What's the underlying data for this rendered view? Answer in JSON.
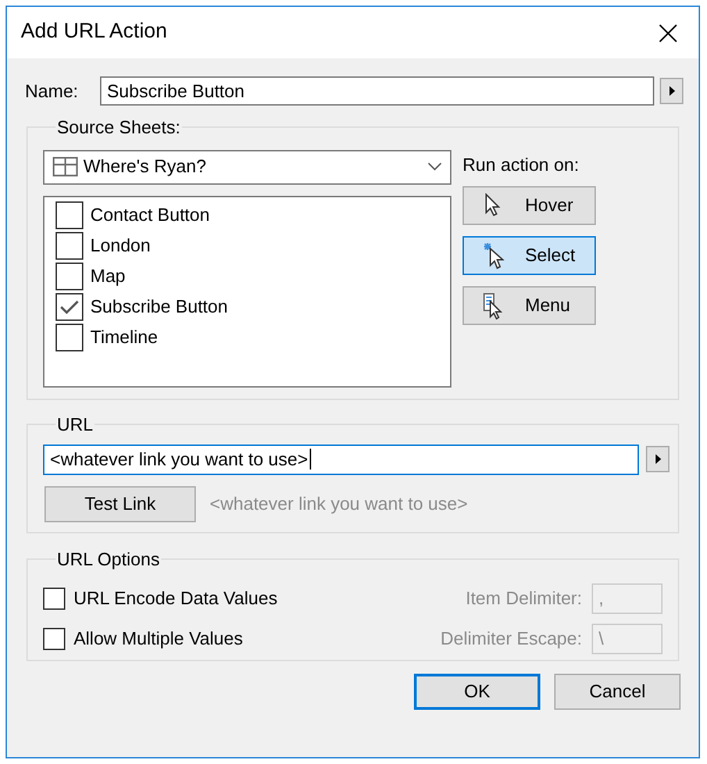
{
  "window": {
    "title": "Add URL Action"
  },
  "name_field": {
    "label": "Name:",
    "value": "Subscribe Button"
  },
  "source_sheets": {
    "legend": "Source Sheets:",
    "dashboard": "Where's Ryan?",
    "sheets": [
      {
        "label": "Contact Button",
        "checked": false
      },
      {
        "label": "London",
        "checked": false
      },
      {
        "label": "Map",
        "checked": false
      },
      {
        "label": "Subscribe Button",
        "checked": true
      },
      {
        "label": "Timeline",
        "checked": false
      }
    ],
    "run_action_label": "Run action on:",
    "run_actions": [
      {
        "kind": "hover",
        "label": "Hover",
        "selected": false
      },
      {
        "kind": "select",
        "label": "Select",
        "selected": true
      },
      {
        "kind": "menu",
        "label": "Menu",
        "selected": false
      }
    ]
  },
  "url": {
    "legend": "URL",
    "value": "<whatever link you want to use>",
    "test_button": "Test Link",
    "preview": "<whatever link you want to use>"
  },
  "url_options": {
    "legend": "URL Options",
    "options": [
      {
        "label": "URL Encode Data Values",
        "checked": false,
        "field_label": "Item Delimiter:",
        "field_value": ",",
        "field_disabled": true
      },
      {
        "label": "Allow Multiple Values",
        "checked": false,
        "field_label": "Delimiter Escape:",
        "field_value": "\\",
        "field_disabled": true
      }
    ]
  },
  "buttons": [
    {
      "label": "OK",
      "default": true
    },
    {
      "label": "Cancel",
      "default": false
    }
  ]
}
